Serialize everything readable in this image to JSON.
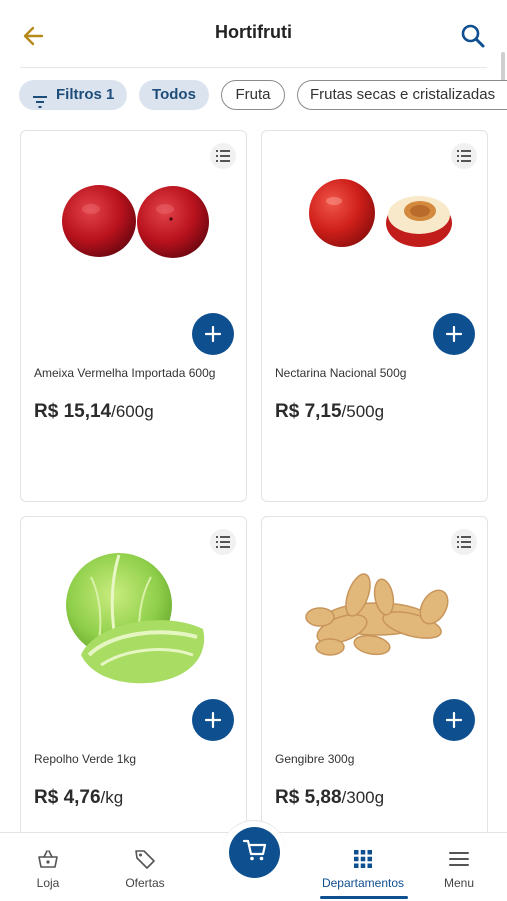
{
  "header": {
    "title": "Hortifruti",
    "back_icon": "arrow-left-icon",
    "search_icon": "search-icon",
    "accent_color": "#B58A1A"
  },
  "filters": {
    "filter_chip": "Filtros 1",
    "chips": [
      "Todos",
      "Fruta",
      "Frutas secas e cristalizadas"
    ],
    "selected": "Todos"
  },
  "products": [
    {
      "name": "Ameixa Vermelha Importada 600g",
      "price": "R$ 15,14",
      "unit": "/600g"
    },
    {
      "name": "Nectarina Nacional 500g",
      "price": "R$ 7,15",
      "unit": "/500g"
    },
    {
      "name": "Repolho Verde 1kg",
      "price": "R$ 4,76",
      "unit": "/kg"
    },
    {
      "name": "Gengibre 300g",
      "price": "R$ 5,88",
      "unit": "/300g"
    }
  ],
  "bottom_nav": {
    "items": [
      {
        "label": "Loja",
        "icon": "basket-icon"
      },
      {
        "label": "Ofertas",
        "icon": "tag-icon"
      },
      {
        "label": "Departamentos",
        "icon": "grid-icon",
        "active": true
      },
      {
        "label": "Menu",
        "icon": "hamburger-icon"
      }
    ],
    "cart_icon": "cart-icon"
  },
  "colors": {
    "primary": "#0E4F8F",
    "chip_bg": "#DBE4EE"
  }
}
